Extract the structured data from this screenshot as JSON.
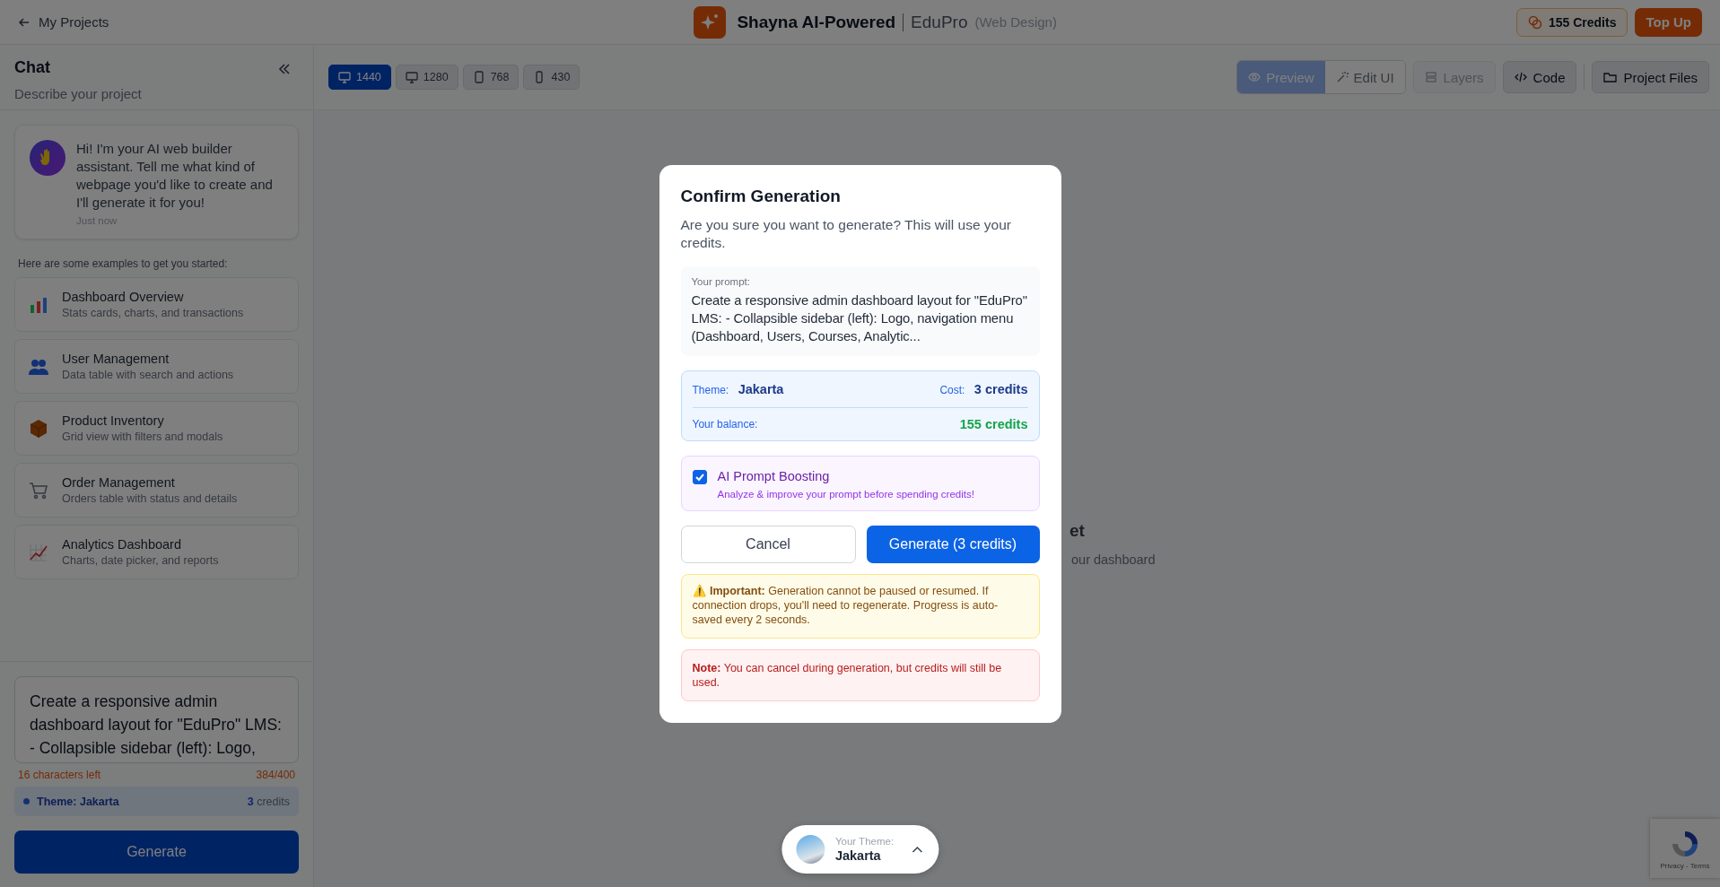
{
  "top_bar": {
    "back_link": "My Projects",
    "brand": "Shayna AI-Powered",
    "project": "EduPro",
    "project_type": "(Web Design)",
    "credits": "155 Credits",
    "top_up": "Top Up"
  },
  "toolbar": {
    "breakpoints": [
      {
        "label": "1440",
        "kind": "desktop",
        "selected": true
      },
      {
        "label": "1280",
        "kind": "desktop",
        "selected": false
      },
      {
        "label": "768",
        "kind": "tablet",
        "selected": false
      },
      {
        "label": "430",
        "kind": "phone",
        "selected": false
      }
    ],
    "views": [
      {
        "label": "Preview",
        "kind": "eye",
        "selected": true
      },
      {
        "label": "Edit UI",
        "kind": "wand",
        "selected": false
      }
    ],
    "layers": {
      "label": "Layers",
      "disabled": true
    },
    "code": "Code",
    "project_files": "Project Files"
  },
  "chat": {
    "title": "Chat",
    "subtitle": "Describe your project",
    "message": {
      "text": "Hi! I'm your AI web builder assistant. Tell me what kind of webpage you'd like to create and I'll generate it for you!",
      "time": "Just now"
    },
    "examples_intro": "Here are some examples to get you started:",
    "examples": [
      {
        "kind": "bar-chart",
        "title": "Dashboard Overview",
        "description": "Stats cards, charts, and transactions"
      },
      {
        "kind": "users",
        "title": "User Management",
        "description": "Data table with search and actions"
      },
      {
        "kind": "box",
        "title": "Product Inventory",
        "description": "Grid view with filters and modals"
      },
      {
        "kind": "cart",
        "title": "Order Management",
        "description": "Orders table with status and details"
      },
      {
        "kind": "line-chart",
        "title": "Analytics Dashboard",
        "description": "Charts, date picker, and reports"
      }
    ],
    "prompt": "Create a responsive admin dashboard layout for \"EduPro\" LMS:\n- Collapsible sidebar (left): Logo,",
    "chars_left": "16 characters left",
    "count": "384/400",
    "theme": "Theme: Jakarta",
    "cost": "3",
    "cost_unit": "credits",
    "generate": "Generate"
  },
  "canvas": {
    "title_fragment": "et",
    "subtitle_fragment": "our dashboard"
  },
  "modal": {
    "title": "Confirm Generation",
    "description": "Are you sure you want to generate? This will use your credits.",
    "prompt_label": "Your prompt:",
    "prompt_text": "Create a responsive admin dashboard layout for \"EduPro\" LMS: - Collapsible sidebar (left): Logo, navigation menu (Dashboard, Users, Courses, Analytic...",
    "theme_label": "Theme:",
    "theme_value": "Jakarta",
    "cost_label": "Cost:",
    "cost_value": "3 credits",
    "balance_label": "Your balance:",
    "balance_value": "155 credits",
    "boosting": {
      "checked": true,
      "title": "AI Prompt Boosting",
      "description": "Analyze & improve your prompt before spending credits!"
    },
    "cancel": "Cancel",
    "confirm": "Generate (3 credits)",
    "important": "⚠️ **Important:** Generation cannot be paused or resumed. If connection drops, you'll need to regenerate. Progress is auto-saved every 2 seconds.",
    "note": "**Note:** You can cancel during generation, but credits will still be used."
  },
  "theme_pill": {
    "label": "Your Theme:",
    "value": "Jakarta"
  },
  "recaptcha": {
    "links": "Privacy - Terms"
  }
}
